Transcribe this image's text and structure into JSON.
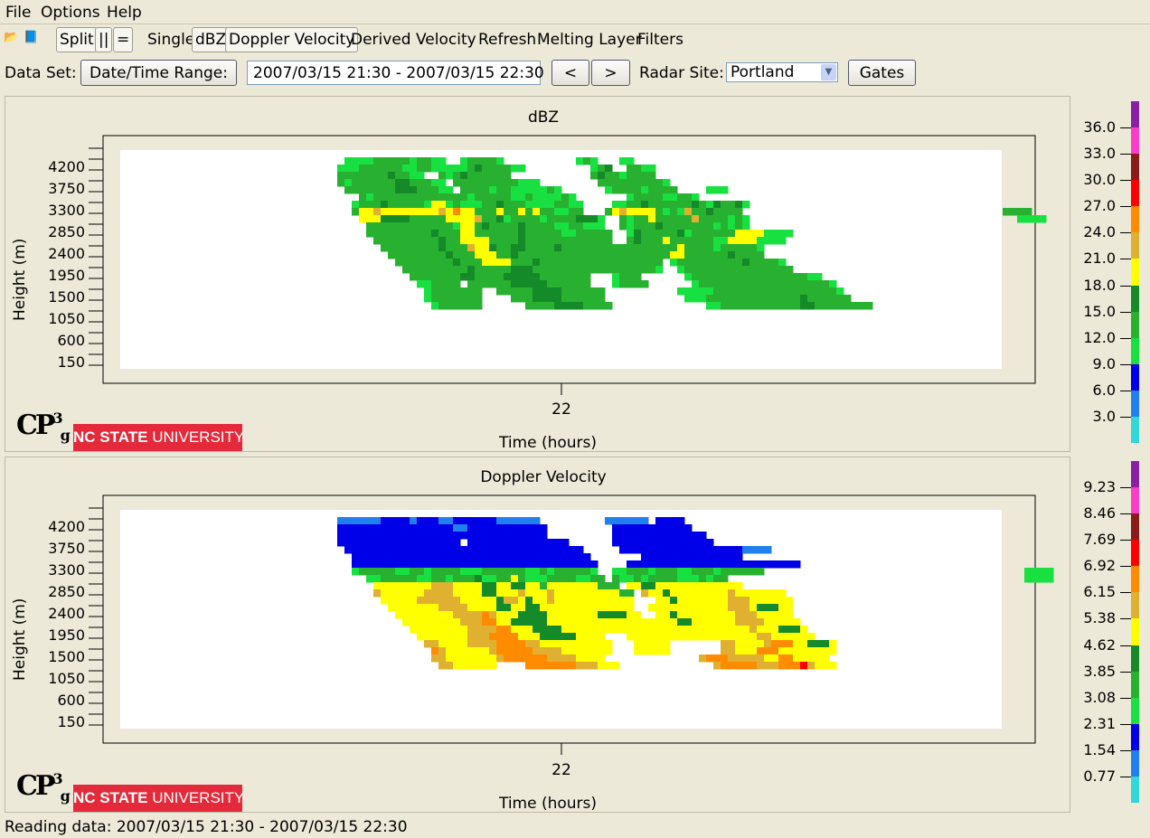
{
  "menu": [
    "File",
    "Options",
    "Help"
  ],
  "toolbar": {
    "split": "Split",
    "parallel": "||",
    "equal": "=",
    "single": "Single",
    "dbz": "dBZ",
    "doppler": "Doppler Velocity",
    "derived": "Derived Velocity",
    "refresh": "Refresh",
    "melting": "Melting Layer",
    "filters": "Filters",
    "icons": [
      "folder-open-icon",
      "book-icon"
    ]
  },
  "dataset": {
    "label": "Data Set:",
    "date_button": "Date/Time Range:",
    "range_value": "2007/03/15 21:30 - 2007/03/15 22:30",
    "prev": "<",
    "next": ">",
    "radar_label": "Radar Site:",
    "radar_value": "Portland",
    "gates": "Gates"
  },
  "panels": [
    {
      "title": "dBZ",
      "ylabel": "Height (m)",
      "xlabel": "Time (hours)",
      "xtick": "22",
      "yticks": [
        "4200",
        "3750",
        "3300",
        "2850",
        "2400",
        "1950",
        "1500",
        "1050",
        "600",
        "150"
      ],
      "colorbar_labels": [
        "36.0",
        "33.0",
        "30.0",
        "27.0",
        "24.0",
        "21.0",
        "18.0",
        "15.0",
        "12.0",
        "9.0",
        "6.0",
        "3.0"
      ],
      "colorbar_colors": [
        "#8a1fa6",
        "#ff3cc8",
        "#8b1a1a",
        "#ff0000",
        "#ff8c00",
        "#e0b030",
        "#ffff00",
        "#148a28",
        "#28b030",
        "#18e040",
        "#0000e8",
        "#2080f0",
        "#30d8d8"
      ]
    },
    {
      "title": "Doppler Velocity",
      "ylabel": "Height (m)",
      "xlabel": "Time (hours)",
      "xtick": "22",
      "yticks": [
        "4200",
        "3750",
        "3300",
        "2850",
        "2400",
        "1950",
        "1500",
        "1050",
        "600",
        "150"
      ],
      "colorbar_labels": [
        "9.23",
        "8.46",
        "7.69",
        "6.92",
        "6.15",
        "5.38",
        "4.62",
        "3.85",
        "3.08",
        "2.31",
        "1.54",
        "0.77"
      ],
      "colorbar_colors": [
        "#8a1fa6",
        "#ff3cc8",
        "#8b1a1a",
        "#ff0000",
        "#ff8c00",
        "#e0b030",
        "#ffff00",
        "#148a28",
        "#28b030",
        "#18e040",
        "#0000e8",
        "#2080f0",
        "#30d8d8"
      ]
    }
  ],
  "logo": {
    "cp": "CP",
    "sup": "3",
    "sub": "g",
    "university_bold": "NC STATE",
    "university_rest": " UNIVERSITY"
  },
  "status": "Reading data: 2007/03/15 21:30 - 2007/03/15 22:30"
}
